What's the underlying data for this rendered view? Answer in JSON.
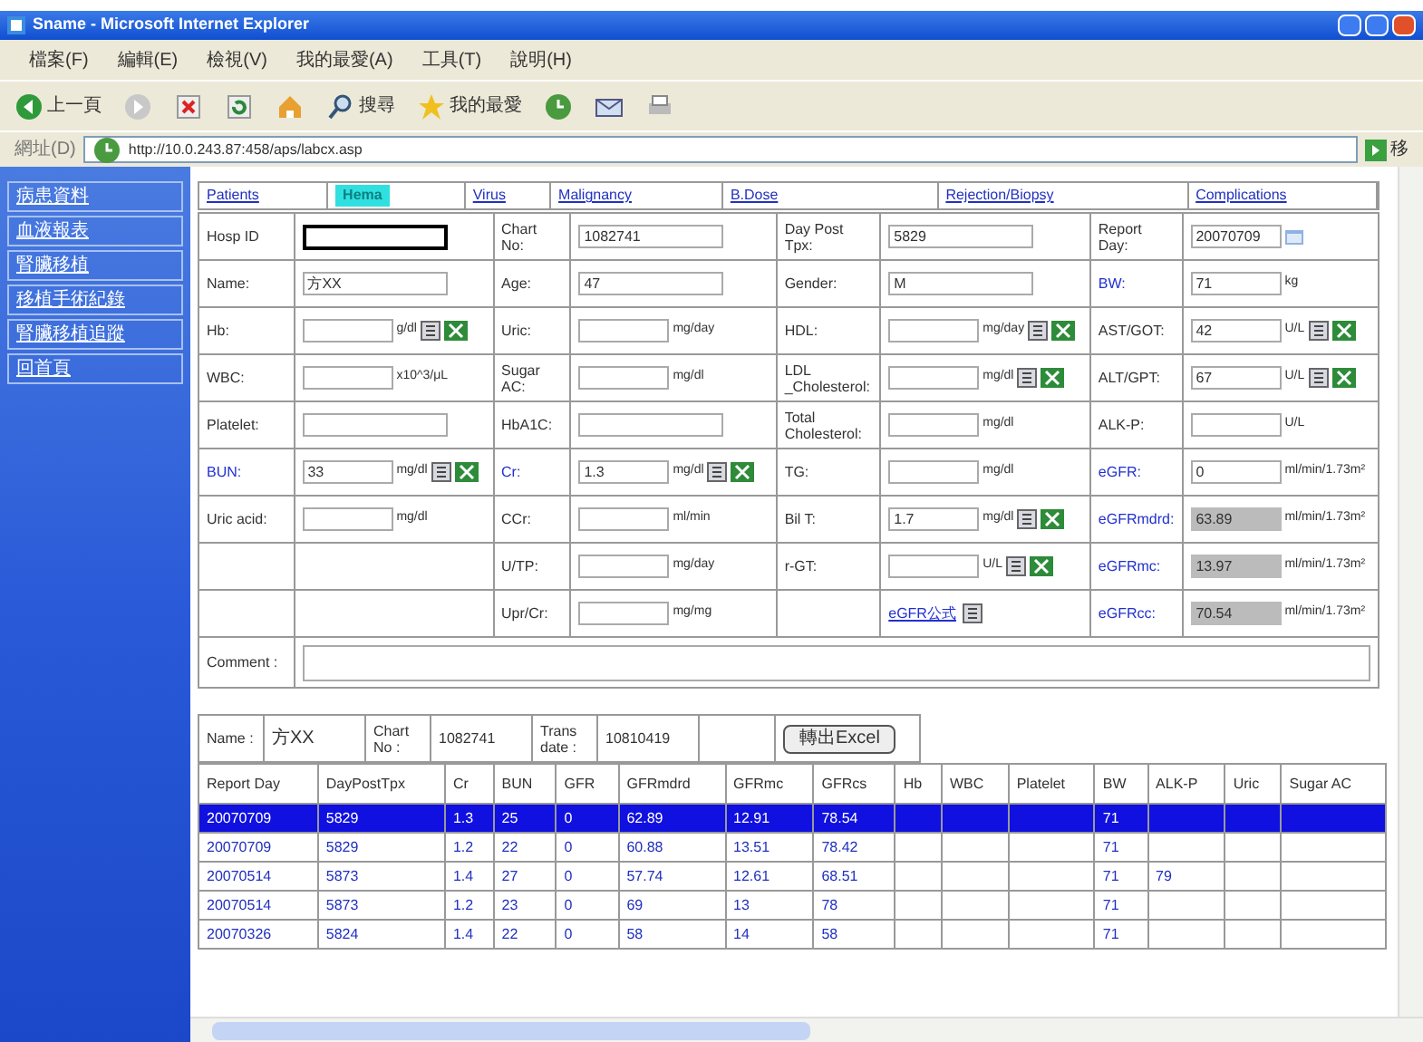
{
  "window": {
    "title": "Sname - Microsoft Internet Explorer"
  },
  "menu": [
    "檔案(F)",
    "編輯(E)",
    "檢視(V)",
    "我的最愛(A)",
    "工具(T)",
    "說明(H)"
  ],
  "toolbar": [
    {
      "kind": "back",
      "label": "上一頁"
    },
    {
      "kind": "forward"
    },
    {
      "kind": "stop"
    },
    {
      "kind": "refresh"
    },
    {
      "kind": "home"
    },
    {
      "kind": "search",
      "label": "搜尋"
    },
    {
      "kind": "favorites",
      "label": "我的最愛"
    },
    {
      "kind": "history"
    },
    {
      "kind": "mail"
    },
    {
      "kind": "print"
    }
  ],
  "address": {
    "label": "網址(D)",
    "value": "http://10.0.243.87:458/aps/labcx.asp",
    "go": "移"
  },
  "sidebar": {
    "items": [
      "病患資料",
      "血液報表",
      "腎臟移植",
      "移植手術紀錄",
      "腎臟移植追蹤",
      "回首頁"
    ]
  },
  "tabs": [
    {
      "label": "Patients",
      "selected": false
    },
    {
      "label": "Hema",
      "selected": true
    },
    {
      "label": "Virus",
      "selected": false
    },
    {
      "label": "Malignancy",
      "selected": false
    },
    {
      "label": "B.Dose",
      "selected": false
    },
    {
      "label": "Rejection/Biopsy",
      "selected": false
    },
    {
      "label": "Complications",
      "selected": false
    }
  ],
  "form": {
    "rows": [
      [
        {
          "label": "Hosp ID",
          "kind": "focused"
        },
        {
          "label": "Chart No:",
          "value": "1082741"
        },
        {
          "label": "Day Post Tpx:",
          "value": "5829"
        },
        {
          "label": "Report Day:",
          "value": "20070709",
          "calendar": true
        }
      ],
      [
        {
          "label": "Name:",
          "value": "方XX"
        },
        {
          "label": "Age:",
          "value": "47"
        },
        {
          "label": "Gender:",
          "value": "M"
        },
        {
          "label": "BW:",
          "link": true,
          "value": "71",
          "unit": "kg"
        }
      ],
      [
        {
          "label": "Hb:",
          "unit": "g/dl",
          "note": true,
          "excel": true
        },
        {
          "label": "Uric:",
          "unit": "mg/day"
        },
        {
          "label": "HDL:",
          "unit": "mg/day",
          "note": true,
          "excel": true
        },
        {
          "label": "AST/GOT:",
          "value": "42",
          "unit": "U/L",
          "note": true,
          "excel": true
        }
      ],
      [
        {
          "label": "WBC:",
          "unit": "x10^3/μL"
        },
        {
          "label": "Sugar AC:",
          "unit": "mg/dl"
        },
        {
          "label": "LDL _Cholesterol:",
          "unit": "mg/dl",
          "note": true,
          "excel": true
        },
        {
          "label": "ALT/GPT:",
          "value": "67",
          "unit": "U/L",
          "note": true,
          "excel": true
        }
      ],
      [
        {
          "label": "Platelet:"
        },
        {
          "label": "HbA1C:"
        },
        {
          "label": "Total Cholesterol:",
          "unit": "mg/dl"
        },
        {
          "label": "ALK-P:",
          "unit": "U/L"
        }
      ],
      [
        {
          "label": "BUN:",
          "link": true,
          "value": "33",
          "unit": "mg/dl",
          "note": true,
          "excel": true
        },
        {
          "label": "Cr:",
          "link": true,
          "value": "1.3",
          "unit": "mg/dl",
          "note": true,
          "excel": true
        },
        {
          "label": "TG:",
          "unit": "mg/dl"
        },
        {
          "label": "eGFR:",
          "link": true,
          "value": "0",
          "unit": "ml/min/1.73m²"
        }
      ],
      [
        {
          "label": "Uric acid:",
          "unit": "mg/dl"
        },
        {
          "label": "CCr:",
          "unit": "ml/min"
        },
        {
          "label": "Bil T:",
          "value": "1.7",
          "unit": "mg/dl",
          "note": true,
          "excel": true
        },
        {
          "label": "eGFRmdrd:",
          "link": true,
          "kind": "readonly",
          "value": "63.89",
          "unit": "ml/min/1.73m²"
        }
      ],
      [
        {
          "kind": "blank"
        },
        {
          "label": "U/TP:",
          "unit": "mg/day"
        },
        {
          "label": "r-GT:",
          "unit": "U/L",
          "note": true,
          "excel": true
        },
        {
          "label": "eGFRmc:",
          "link": true,
          "kind": "readonly",
          "value": "13.97",
          "unit": "ml/min/1.73m²"
        }
      ],
      [
        {
          "kind": "blank"
        },
        {
          "label": "Upr/Cr:",
          "unit": "mg/mg"
        },
        {
          "kind": "linkcell",
          "value": "eGFR公式",
          "note": true
        },
        {
          "label": "eGFRcc:",
          "link": true,
          "kind": "readonly",
          "value": "70.54",
          "unit": "ml/min/1.73m²"
        }
      ]
    ],
    "comment_label": "Comment :"
  },
  "summary": {
    "cells": [
      "Name :",
      "方XX",
      "Chart No :",
      "1082741",
      "Trans date :",
      "10810419"
    ],
    "button": "轉出Excel"
  },
  "table": {
    "columns": [
      "Report Day",
      "DayPostTpx",
      "Cr",
      "BUN",
      "GFR",
      "GFRmdrd",
      "GFRmc",
      "GFRcs",
      "Hb",
      "WBC",
      "Platelet",
      "BW",
      "ALK-P",
      "Uric",
      "Sugar AC"
    ],
    "rows": [
      {
        "selected": true,
        "cells": [
          "20070709",
          "5829",
          "1.3",
          "25",
          "0",
          "62.89",
          "12.91",
          "78.54",
          "",
          "",
          "",
          "71",
          "",
          "",
          ""
        ]
      },
      {
        "selected": false,
        "cells": [
          "20070709",
          "5829",
          "1.2",
          "22",
          "0",
          "60.88",
          "13.51",
          "78.42",
          "",
          "",
          "",
          "71",
          "",
          "",
          ""
        ]
      },
      {
        "selected": false,
        "cells": [
          "20070514",
          "5873",
          "1.4",
          "27",
          "0",
          "57.74",
          "12.61",
          "68.51",
          "",
          "",
          "",
          "71",
          "79",
          "",
          ""
        ]
      },
      {
        "selected": false,
        "cells": [
          "20070514",
          "5873",
          "1.2",
          "23",
          "0",
          "69",
          "13",
          "78",
          "",
          "",
          "",
          "71",
          "",
          "",
          ""
        ]
      },
      {
        "selected": false,
        "cells": [
          "20070326",
          "5824",
          "1.4",
          "22",
          "0",
          "58",
          "14",
          "58",
          "",
          "",
          "",
          "71",
          "",
          "",
          ""
        ]
      }
    ]
  }
}
